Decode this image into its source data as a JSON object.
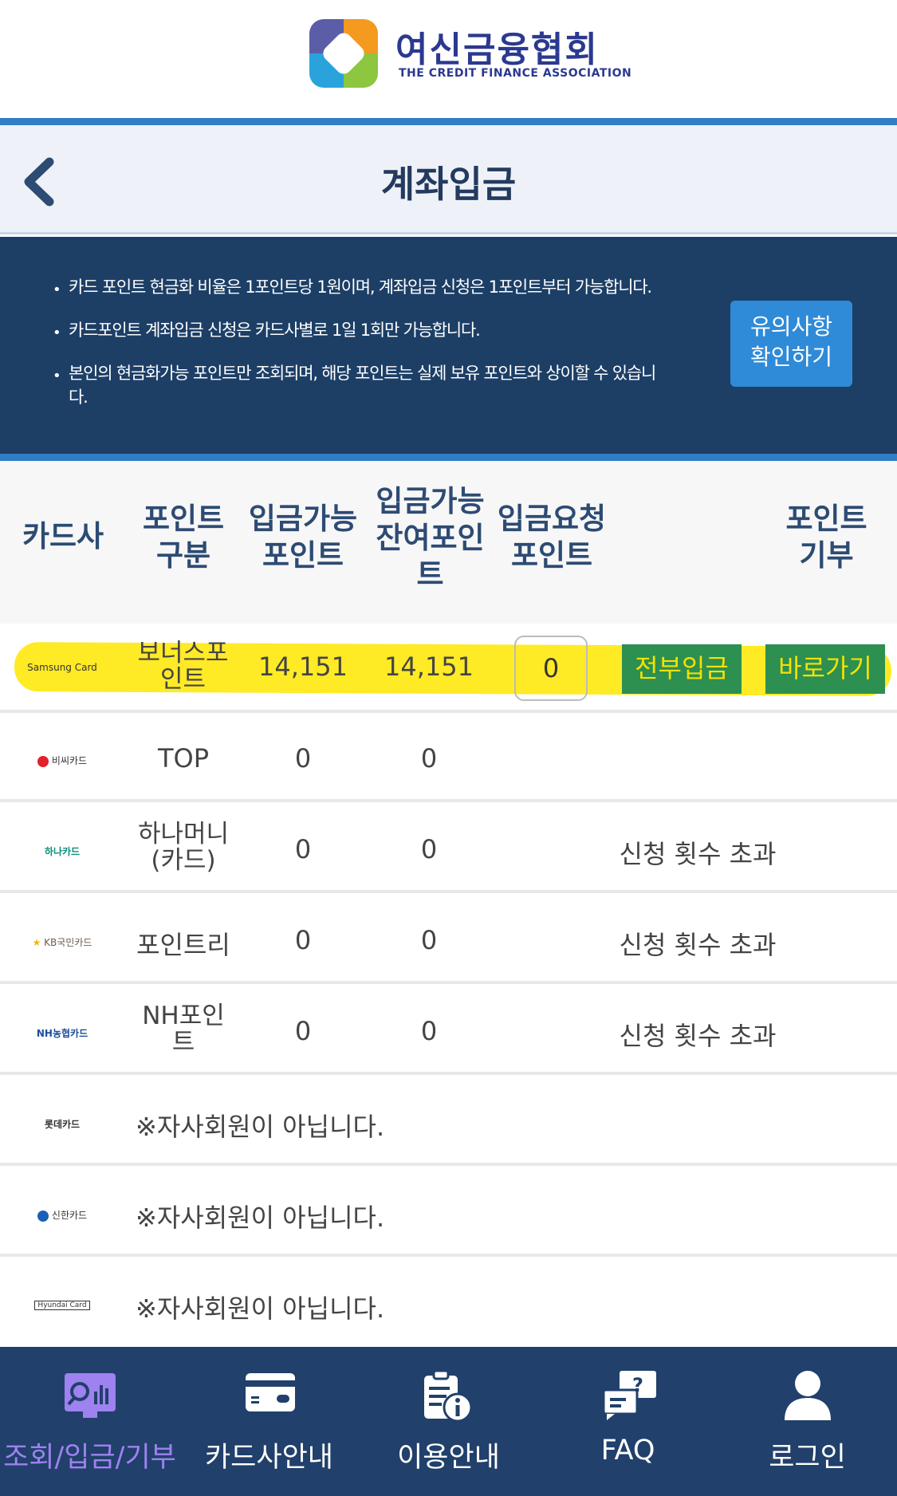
{
  "header": {
    "org_name_ko": "여신금융협회",
    "org_name_en": "THE CREDIT FINANCE ASSOCIATION"
  },
  "title_bar": {
    "title": "계좌입금"
  },
  "notice": {
    "items": [
      "카드 포인트 현금화 비율은 1포인트당 1원이며, 계좌입금 신청은 1포인트부터 가능합니다.",
      "카드포인트 계좌입금 신청은 카드사별로 1일 1회만 가능합니다.",
      "본인의 현금화가능 포인트만 조회되며, 해당 포인트는 실제 보유 포인트와 상이할 수 있습니다."
    ],
    "caution_button": {
      "line1": "유의사항",
      "line2": "확인하기"
    }
  },
  "table": {
    "headers": {
      "card_company": "카드사",
      "point_type": "포인트\n구분",
      "available": "입금가능\n포인트",
      "remaining": "입금가능\n잔여포인\n트",
      "requested": "입금요청\n포인트",
      "donate": "포인트\n기부"
    },
    "rows": [
      {
        "logo": "Samsung Card",
        "point_type": "보너스포\n인트",
        "available": "14,151",
        "remaining": "14,151",
        "request_value": "0",
        "deposit_all_label": "전부입금",
        "go_label": "바로가기"
      },
      {
        "logo": "비씨카드",
        "point_type": "TOP",
        "available": "0",
        "remaining": "0",
        "status": ""
      },
      {
        "logo": "하나카드",
        "point_type": "하나머니\n(카드)",
        "available": "0",
        "remaining": "0",
        "status": "신청 횟수 초과"
      },
      {
        "logo": "KB국민카드",
        "point_type": "포인트리",
        "available": "0",
        "remaining": "0",
        "status": "신청 횟수 초과"
      },
      {
        "logo": "NH농협카드",
        "point_type": "NH포인\n트",
        "available": "0",
        "remaining": "0",
        "status": "신청 횟수 초과"
      },
      {
        "logo": "롯데카드",
        "message": "※자사회원이 아닙니다."
      },
      {
        "logo": "신한카드",
        "message": "※자사회원이 아닙니다."
      },
      {
        "logo": "Hyundai Card",
        "message": "※자사회원이 아닙니다."
      }
    ]
  },
  "bottom_nav": {
    "items": [
      {
        "label": "조회/입금/기부",
        "icon": "search-chart-icon",
        "active": true
      },
      {
        "label": "카드사안내",
        "icon": "card-icon",
        "active": false
      },
      {
        "label": "이용안내",
        "icon": "clipboard-info-icon",
        "active": false
      },
      {
        "label": "FAQ",
        "icon": "faq-icon",
        "active": false
      },
      {
        "label": "로그인",
        "icon": "user-icon",
        "active": false
      }
    ]
  },
  "colors": {
    "brand_blue": "#2f7ec6",
    "notice_bg": "#1d3f66",
    "nav_bg": "#21406b",
    "active_nav": "#9e82f0",
    "button_green": "#2d8f50",
    "highlight": "#ffe600"
  }
}
